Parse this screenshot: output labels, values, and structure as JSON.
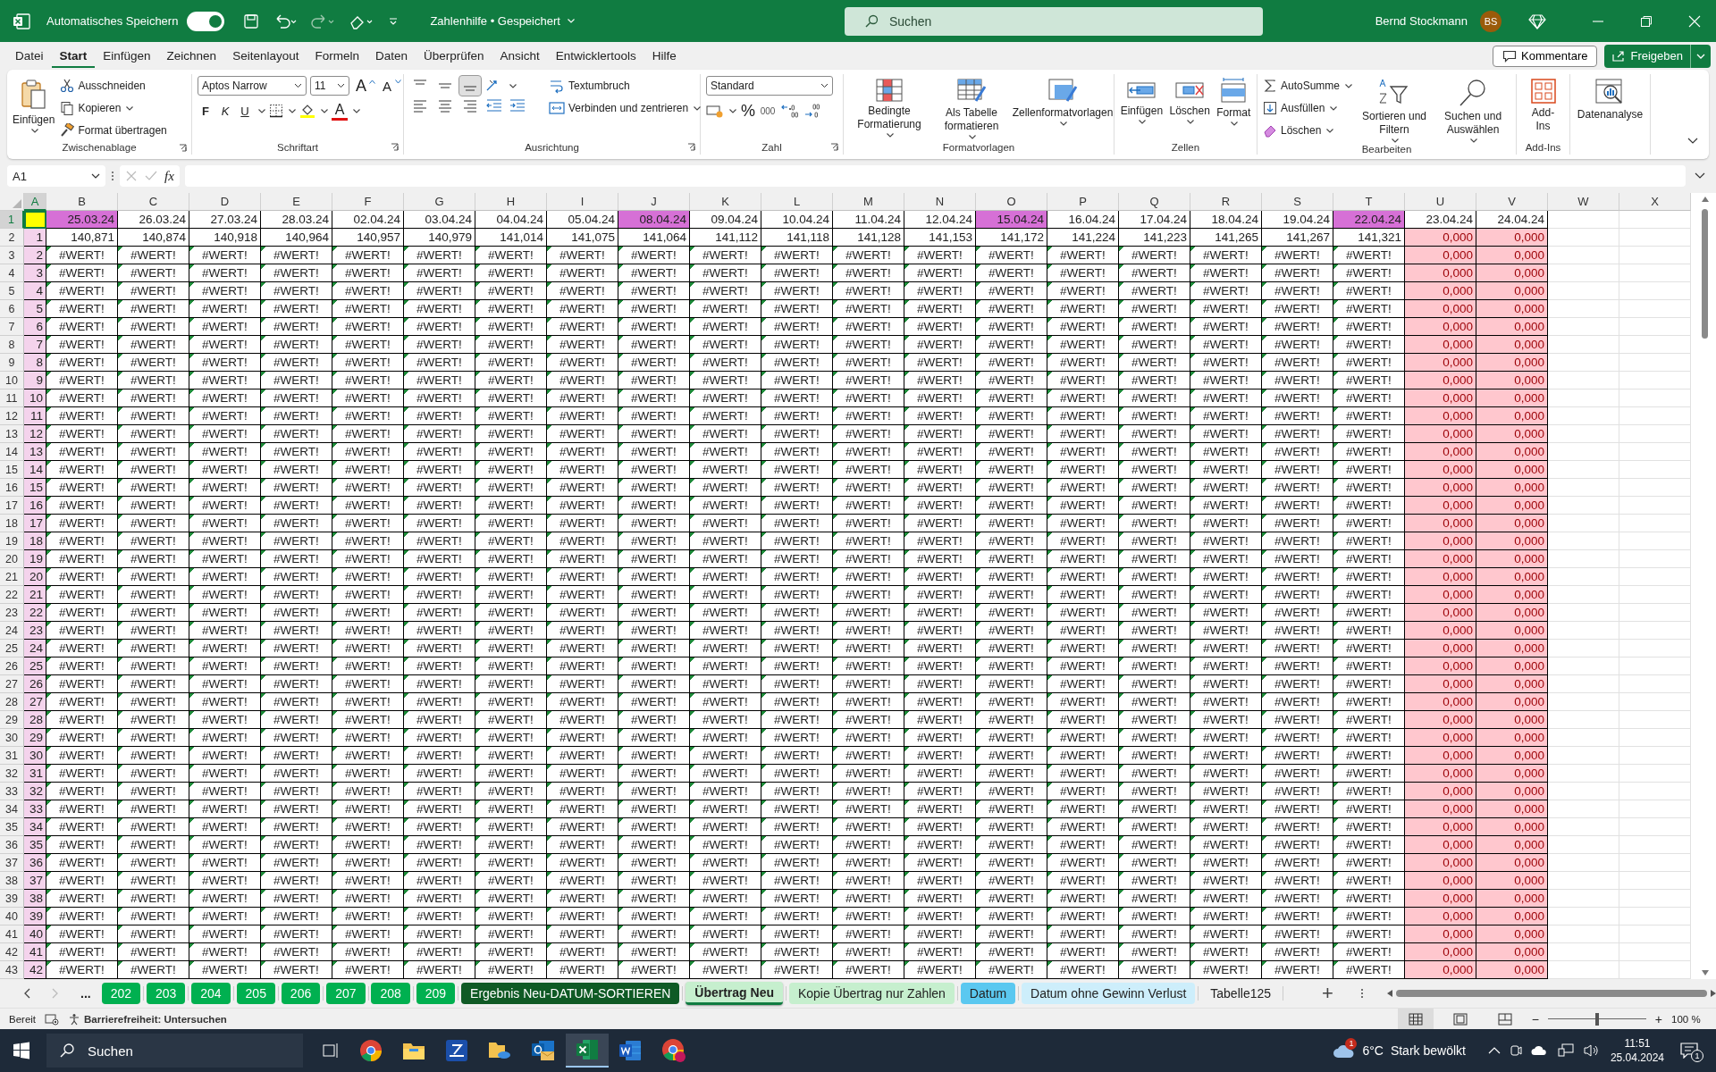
{
  "title_bar": {
    "autosave_label": "Automatisches Speichern",
    "autosave_on": true,
    "document_title": "Zahlenhilfe • Gespeichert",
    "search_placeholder": "Suchen",
    "user_name": "Bernd Stockmann",
    "user_initials": "BS"
  },
  "menu_tabs": [
    {
      "label": "Datei",
      "selected": false
    },
    {
      "label": "Start",
      "selected": true
    },
    {
      "label": "Einfügen",
      "selected": false
    },
    {
      "label": "Zeichnen",
      "selected": false
    },
    {
      "label": "Seitenlayout",
      "selected": false
    },
    {
      "label": "Formeln",
      "selected": false
    },
    {
      "label": "Daten",
      "selected": false
    },
    {
      "label": "Überprüfen",
      "selected": false
    },
    {
      "label": "Ansicht",
      "selected": false
    },
    {
      "label": "Entwicklertools",
      "selected": false
    },
    {
      "label": "Hilfe",
      "selected": false
    }
  ],
  "comments_button": "Kommentare",
  "share_button": "Freigeben",
  "ribbon": {
    "clipboard": {
      "title": "Zwischenablage",
      "paste": "Einfügen",
      "cut": "Ausschneiden",
      "copy": "Kopieren",
      "painter": "Format übertragen"
    },
    "font": {
      "title": "Schriftart",
      "family": "Aptos Narrow",
      "size": "11",
      "grow": "A",
      "shrink": "A",
      "bold": "F",
      "italic": "K",
      "underline": "U",
      "color_letter": "A"
    },
    "alignment": {
      "title": "Ausrichtung",
      "wrap": "Textumbruch",
      "merge": "Verbinden und zentrieren"
    },
    "number": {
      "title": "Zahl",
      "format": "Standard",
      "percent": "%",
      "thousands": "000"
    },
    "styles": {
      "title": "Formatvorlagen",
      "conditional": "Bedingte Formatierung",
      "as_table": "Als Tabelle formatieren",
      "cell_styles": "Zellenformatvorlagen"
    },
    "cells": {
      "title": "Zellen",
      "insert": "Einfügen",
      "delete": "Löschen",
      "format": "Format"
    },
    "editing": {
      "title": "Bearbeiten",
      "autosum": "AutoSumme",
      "fill": "Ausfüllen",
      "clear": "Löschen",
      "sort": "Sortieren und Filtern",
      "find": "Suchen und Auswählen"
    },
    "addins": {
      "title": "Add-Ins",
      "button": "Add-Ins"
    },
    "analysis": {
      "button": "Datenanalyse"
    }
  },
  "formula_bar": {
    "name_box": "A1",
    "fx": "fx"
  },
  "sheet": {
    "columns": [
      {
        "label": "A",
        "kind": "index",
        "selected": true
      },
      {
        "label": "B",
        "kind": "value",
        "selected": false
      },
      {
        "label": "C",
        "kind": "value",
        "selected": false
      },
      {
        "label": "D",
        "kind": "value",
        "selected": false
      },
      {
        "label": "E",
        "kind": "value",
        "selected": false
      },
      {
        "label": "F",
        "kind": "value",
        "selected": false
      },
      {
        "label": "G",
        "kind": "value",
        "selected": false
      },
      {
        "label": "H",
        "kind": "value",
        "selected": false
      },
      {
        "label": "I",
        "kind": "value",
        "selected": false
      },
      {
        "label": "J",
        "kind": "value",
        "selected": false
      },
      {
        "label": "K",
        "kind": "value",
        "selected": false
      },
      {
        "label": "L",
        "kind": "value",
        "selected": false
      },
      {
        "label": "M",
        "kind": "value",
        "selected": false
      },
      {
        "label": "N",
        "kind": "value",
        "selected": false
      },
      {
        "label": "O",
        "kind": "value",
        "selected": false
      },
      {
        "label": "P",
        "kind": "value",
        "selected": false
      },
      {
        "label": "Q",
        "kind": "value",
        "selected": false
      },
      {
        "label": "R",
        "kind": "value",
        "selected": false
      },
      {
        "label": "S",
        "kind": "value",
        "selected": false
      },
      {
        "label": "T",
        "kind": "value",
        "selected": false
      },
      {
        "label": "U",
        "kind": "alert",
        "selected": false
      },
      {
        "label": "V",
        "kind": "alert",
        "selected": false
      },
      {
        "label": "W",
        "kind": "blank",
        "selected": false
      },
      {
        "label": "X",
        "kind": "blank",
        "selected": false
      }
    ],
    "rows": [
      {
        "label": "1",
        "selected": true,
        "flagged": false,
        "cells": [
          {
            "color": "#ffff00"
          },
          {
            "text": "25.03.24",
            "color": "#d670d6"
          },
          {
            "text": "26.03.24"
          },
          {
            "text": "27.03.24"
          },
          {
            "text": "28.03.24"
          },
          {
            "text": "02.04.24"
          },
          {
            "text": "03.04.24"
          },
          {
            "text": "04.04.24"
          },
          {
            "text": "05.04.24"
          },
          {
            "text": "08.04.24",
            "color": "#d670d6"
          },
          {
            "text": "09.04.24"
          },
          {
            "text": "10.04.24"
          },
          {
            "text": "11.04.24"
          },
          {
            "text": "12.04.24"
          },
          {
            "text": "15.04.24",
            "color": "#d670d6"
          },
          {
            "text": "16.04.24"
          },
          {
            "text": "17.04.24"
          },
          {
            "text": "18.04.24"
          },
          {
            "text": "19.04.24"
          },
          {
            "text": "22.04.24",
            "color": "#d670d6"
          },
          {
            "text": "23.04.24"
          },
          {
            "text": "24.04.24"
          }
        ]
      },
      {
        "label": "2",
        "selected": false,
        "flagged": false,
        "cells": [
          "1",
          "140,871",
          "140,874",
          "140,918",
          "140,964",
          "140,957",
          "140,979",
          "141,014",
          "141,075",
          "141,064",
          "141,112",
          "141,118",
          "141,128",
          "141,153",
          "141,172",
          "141,224",
          "141,223",
          "141,265",
          "141,267",
          "141,321",
          "0,000",
          "0,000"
        ]
      },
      {
        "label": "3",
        "selected": false,
        "flagged": true,
        "cells": [
          "2",
          "#WERT!",
          "#WERT!",
          "#WERT!",
          "#WERT!",
          "#WERT!",
          "#WERT!",
          "#WERT!",
          "#WERT!",
          "#WERT!",
          "#WERT!",
          "#WERT!",
          "#WERT!",
          "#WERT!",
          "#WERT!",
          "#WERT!",
          "#WERT!",
          "#WERT!",
          "#WERT!",
          "#WERT!",
          "0,000",
          "0,000"
        ]
      },
      {
        "label": "4",
        "selected": false,
        "flagged": true,
        "cells": [
          "3",
          "#WERT!",
          "#WERT!",
          "#WERT!",
          "#WERT!",
          "#WERT!",
          "#WERT!",
          "#WERT!",
          "#WERT!",
          "#WERT!",
          "#WERT!",
          "#WERT!",
          "#WERT!",
          "#WERT!",
          "#WERT!",
          "#WERT!",
          "#WERT!",
          "#WERT!",
          "#WERT!",
          "#WERT!",
          "0,000",
          "0,000"
        ]
      },
      {
        "label": "5",
        "selected": false,
        "flagged": true,
        "cells": [
          "4",
          "#WERT!",
          "#WERT!",
          "#WERT!",
          "#WERT!",
          "#WERT!",
          "#WERT!",
          "#WERT!",
          "#WERT!",
          "#WERT!",
          "#WERT!",
          "#WERT!",
          "#WERT!",
          "#WERT!",
          "#WERT!",
          "#WERT!",
          "#WERT!",
          "#WERT!",
          "#WERT!",
          "#WERT!",
          "0,000",
          "0,000"
        ]
      },
      {
        "label": "6",
        "selected": false,
        "flagged": true,
        "cells": [
          "5",
          "#WERT!",
          "#WERT!",
          "#WERT!",
          "#WERT!",
          "#WERT!",
          "#WERT!",
          "#WERT!",
          "#WERT!",
          "#WERT!",
          "#WERT!",
          "#WERT!",
          "#WERT!",
          "#WERT!",
          "#WERT!",
          "#WERT!",
          "#WERT!",
          "#WERT!",
          "#WERT!",
          "#WERT!",
          "0,000",
          "0,000"
        ]
      },
      {
        "label": "7",
        "selected": false,
        "flagged": true,
        "cells": [
          "6",
          "#WERT!",
          "#WERT!",
          "#WERT!",
          "#WERT!",
          "#WERT!",
          "#WERT!",
          "#WERT!",
          "#WERT!",
          "#WERT!",
          "#WERT!",
          "#WERT!",
          "#WERT!",
          "#WERT!",
          "#WERT!",
          "#WERT!",
          "#WERT!",
          "#WERT!",
          "#WERT!",
          "#WERT!",
          "0,000",
          "0,000"
        ]
      },
      {
        "label": "8",
        "selected": false,
        "flagged": true,
        "cells": [
          "7",
          "#WERT!",
          "#WERT!",
          "#WERT!",
          "#WERT!",
          "#WERT!",
          "#WERT!",
          "#WERT!",
          "#WERT!",
          "#WERT!",
          "#WERT!",
          "#WERT!",
          "#WERT!",
          "#WERT!",
          "#WERT!",
          "#WERT!",
          "#WERT!",
          "#WERT!",
          "#WERT!",
          "#WERT!",
          "0,000",
          "0,000"
        ]
      },
      {
        "label": "9",
        "selected": false,
        "flagged": true,
        "cells": [
          "8",
          "#WERT!",
          "#WERT!",
          "#WERT!",
          "#WERT!",
          "#WERT!",
          "#WERT!",
          "#WERT!",
          "#WERT!",
          "#WERT!",
          "#WERT!",
          "#WERT!",
          "#WERT!",
          "#WERT!",
          "#WERT!",
          "#WERT!",
          "#WERT!",
          "#WERT!",
          "#WERT!",
          "#WERT!",
          "0,000",
          "0,000"
        ]
      },
      {
        "label": "10",
        "selected": false,
        "flagged": true,
        "cells": [
          "9",
          "#WERT!",
          "#WERT!",
          "#WERT!",
          "#WERT!",
          "#WERT!",
          "#WERT!",
          "#WERT!",
          "#WERT!",
          "#WERT!",
          "#WERT!",
          "#WERT!",
          "#WERT!",
          "#WERT!",
          "#WERT!",
          "#WERT!",
          "#WERT!",
          "#WERT!",
          "#WERT!",
          "#WERT!",
          "0,000",
          "0,000"
        ]
      },
      {
        "label": "11",
        "selected": false,
        "flagged": true,
        "cells": [
          "10",
          "#WERT!",
          "#WERT!",
          "#WERT!",
          "#WERT!",
          "#WERT!",
          "#WERT!",
          "#WERT!",
          "#WERT!",
          "#WERT!",
          "#WERT!",
          "#WERT!",
          "#WERT!",
          "#WERT!",
          "#WERT!",
          "#WERT!",
          "#WERT!",
          "#WERT!",
          "#WERT!",
          "#WERT!",
          "0,000",
          "0,000"
        ]
      },
      {
        "label": "12",
        "selected": false,
        "flagged": true,
        "cells": [
          "11",
          "#WERT!",
          "#WERT!",
          "#WERT!",
          "#WERT!",
          "#WERT!",
          "#WERT!",
          "#WERT!",
          "#WERT!",
          "#WERT!",
          "#WERT!",
          "#WERT!",
          "#WERT!",
          "#WERT!",
          "#WERT!",
          "#WERT!",
          "#WERT!",
          "#WERT!",
          "#WERT!",
          "#WERT!",
          "0,000",
          "0,000"
        ]
      },
      {
        "label": "13",
        "selected": false,
        "flagged": true,
        "cells": [
          "12",
          "#WERT!",
          "#WERT!",
          "#WERT!",
          "#WERT!",
          "#WERT!",
          "#WERT!",
          "#WERT!",
          "#WERT!",
          "#WERT!",
          "#WERT!",
          "#WERT!",
          "#WERT!",
          "#WERT!",
          "#WERT!",
          "#WERT!",
          "#WERT!",
          "#WERT!",
          "#WERT!",
          "#WERT!",
          "0,000",
          "0,000"
        ]
      },
      {
        "label": "14",
        "selected": false,
        "flagged": true,
        "cells": [
          "13",
          "#WERT!",
          "#WERT!",
          "#WERT!",
          "#WERT!",
          "#WERT!",
          "#WERT!",
          "#WERT!",
          "#WERT!",
          "#WERT!",
          "#WERT!",
          "#WERT!",
          "#WERT!",
          "#WERT!",
          "#WERT!",
          "#WERT!",
          "#WERT!",
          "#WERT!",
          "#WERT!",
          "#WERT!",
          "0,000",
          "0,000"
        ]
      },
      {
        "label": "15",
        "selected": false,
        "flagged": true,
        "cells": [
          "14",
          "#WERT!",
          "#WERT!",
          "#WERT!",
          "#WERT!",
          "#WERT!",
          "#WERT!",
          "#WERT!",
          "#WERT!",
          "#WERT!",
          "#WERT!",
          "#WERT!",
          "#WERT!",
          "#WERT!",
          "#WERT!",
          "#WERT!",
          "#WERT!",
          "#WERT!",
          "#WERT!",
          "#WERT!",
          "0,000",
          "0,000"
        ]
      },
      {
        "label": "16",
        "selected": false,
        "flagged": true,
        "cells": [
          "15",
          "#WERT!",
          "#WERT!",
          "#WERT!",
          "#WERT!",
          "#WERT!",
          "#WERT!",
          "#WERT!",
          "#WERT!",
          "#WERT!",
          "#WERT!",
          "#WERT!",
          "#WERT!",
          "#WERT!",
          "#WERT!",
          "#WERT!",
          "#WERT!",
          "#WERT!",
          "#WERT!",
          "#WERT!",
          "0,000",
          "0,000"
        ]
      },
      {
        "label": "17",
        "selected": false,
        "flagged": true,
        "cells": [
          "16",
          "#WERT!",
          "#WERT!",
          "#WERT!",
          "#WERT!",
          "#WERT!",
          "#WERT!",
          "#WERT!",
          "#WERT!",
          "#WERT!",
          "#WERT!",
          "#WERT!",
          "#WERT!",
          "#WERT!",
          "#WERT!",
          "#WERT!",
          "#WERT!",
          "#WERT!",
          "#WERT!",
          "#WERT!",
          "0,000",
          "0,000"
        ]
      },
      {
        "label": "18",
        "selected": false,
        "flagged": true,
        "cells": [
          "17",
          "#WERT!",
          "#WERT!",
          "#WERT!",
          "#WERT!",
          "#WERT!",
          "#WERT!",
          "#WERT!",
          "#WERT!",
          "#WERT!",
          "#WERT!",
          "#WERT!",
          "#WERT!",
          "#WERT!",
          "#WERT!",
          "#WERT!",
          "#WERT!",
          "#WERT!",
          "#WERT!",
          "#WERT!",
          "0,000",
          "0,000"
        ]
      },
      {
        "label": "19",
        "selected": false,
        "flagged": true,
        "cells": [
          "18",
          "#WERT!",
          "#WERT!",
          "#WERT!",
          "#WERT!",
          "#WERT!",
          "#WERT!",
          "#WERT!",
          "#WERT!",
          "#WERT!",
          "#WERT!",
          "#WERT!",
          "#WERT!",
          "#WERT!",
          "#WERT!",
          "#WERT!",
          "#WERT!",
          "#WERT!",
          "#WERT!",
          "#WERT!",
          "0,000",
          "0,000"
        ]
      },
      {
        "label": "20",
        "selected": false,
        "flagged": true,
        "cells": [
          "19",
          "#WERT!",
          "#WERT!",
          "#WERT!",
          "#WERT!",
          "#WERT!",
          "#WERT!",
          "#WERT!",
          "#WERT!",
          "#WERT!",
          "#WERT!",
          "#WERT!",
          "#WERT!",
          "#WERT!",
          "#WERT!",
          "#WERT!",
          "#WERT!",
          "#WERT!",
          "#WERT!",
          "#WERT!",
          "0,000",
          "0,000"
        ]
      },
      {
        "label": "21",
        "selected": false,
        "flagged": true,
        "cells": [
          "20",
          "#WERT!",
          "#WERT!",
          "#WERT!",
          "#WERT!",
          "#WERT!",
          "#WERT!",
          "#WERT!",
          "#WERT!",
          "#WERT!",
          "#WERT!",
          "#WERT!",
          "#WERT!",
          "#WERT!",
          "#WERT!",
          "#WERT!",
          "#WERT!",
          "#WERT!",
          "#WERT!",
          "#WERT!",
          "0,000",
          "0,000"
        ]
      },
      {
        "label": "22",
        "selected": false,
        "flagged": true,
        "cells": [
          "21",
          "#WERT!",
          "#WERT!",
          "#WERT!",
          "#WERT!",
          "#WERT!",
          "#WERT!",
          "#WERT!",
          "#WERT!",
          "#WERT!",
          "#WERT!",
          "#WERT!",
          "#WERT!",
          "#WERT!",
          "#WERT!",
          "#WERT!",
          "#WERT!",
          "#WERT!",
          "#WERT!",
          "#WERT!",
          "0,000",
          "0,000"
        ]
      },
      {
        "label": "23",
        "selected": false,
        "flagged": true,
        "cells": [
          "22",
          "#WERT!",
          "#WERT!",
          "#WERT!",
          "#WERT!",
          "#WERT!",
          "#WERT!",
          "#WERT!",
          "#WERT!",
          "#WERT!",
          "#WERT!",
          "#WERT!",
          "#WERT!",
          "#WERT!",
          "#WERT!",
          "#WERT!",
          "#WERT!",
          "#WERT!",
          "#WERT!",
          "#WERT!",
          "0,000",
          "0,000"
        ]
      },
      {
        "label": "24",
        "selected": false,
        "flagged": true,
        "cells": [
          "23",
          "#WERT!",
          "#WERT!",
          "#WERT!",
          "#WERT!",
          "#WERT!",
          "#WERT!",
          "#WERT!",
          "#WERT!",
          "#WERT!",
          "#WERT!",
          "#WERT!",
          "#WERT!",
          "#WERT!",
          "#WERT!",
          "#WERT!",
          "#WERT!",
          "#WERT!",
          "#WERT!",
          "#WERT!",
          "0,000",
          "0,000"
        ]
      },
      {
        "label": "25",
        "selected": false,
        "flagged": true,
        "cells": [
          "24",
          "#WERT!",
          "#WERT!",
          "#WERT!",
          "#WERT!",
          "#WERT!",
          "#WERT!",
          "#WERT!",
          "#WERT!",
          "#WERT!",
          "#WERT!",
          "#WERT!",
          "#WERT!",
          "#WERT!",
          "#WERT!",
          "#WERT!",
          "#WERT!",
          "#WERT!",
          "#WERT!",
          "#WERT!",
          "0,000",
          "0,000"
        ]
      },
      {
        "label": "26",
        "selected": false,
        "flagged": true,
        "cells": [
          "25",
          "#WERT!",
          "#WERT!",
          "#WERT!",
          "#WERT!",
          "#WERT!",
          "#WERT!",
          "#WERT!",
          "#WERT!",
          "#WERT!",
          "#WERT!",
          "#WERT!",
          "#WERT!",
          "#WERT!",
          "#WERT!",
          "#WERT!",
          "#WERT!",
          "#WERT!",
          "#WERT!",
          "#WERT!",
          "0,000",
          "0,000"
        ]
      },
      {
        "label": "27",
        "selected": false,
        "flagged": true,
        "cells": [
          "26",
          "#WERT!",
          "#WERT!",
          "#WERT!",
          "#WERT!",
          "#WERT!",
          "#WERT!",
          "#WERT!",
          "#WERT!",
          "#WERT!",
          "#WERT!",
          "#WERT!",
          "#WERT!",
          "#WERT!",
          "#WERT!",
          "#WERT!",
          "#WERT!",
          "#WERT!",
          "#WERT!",
          "#WERT!",
          "0,000",
          "0,000"
        ]
      },
      {
        "label": "28",
        "selected": false,
        "flagged": true,
        "cells": [
          "27",
          "#WERT!",
          "#WERT!",
          "#WERT!",
          "#WERT!",
          "#WERT!",
          "#WERT!",
          "#WERT!",
          "#WERT!",
          "#WERT!",
          "#WERT!",
          "#WERT!",
          "#WERT!",
          "#WERT!",
          "#WERT!",
          "#WERT!",
          "#WERT!",
          "#WERT!",
          "#WERT!",
          "#WERT!",
          "0,000",
          "0,000"
        ]
      },
      {
        "label": "29",
        "selected": false,
        "flagged": true,
        "cells": [
          "28",
          "#WERT!",
          "#WERT!",
          "#WERT!",
          "#WERT!",
          "#WERT!",
          "#WERT!",
          "#WERT!",
          "#WERT!",
          "#WERT!",
          "#WERT!",
          "#WERT!",
          "#WERT!",
          "#WERT!",
          "#WERT!",
          "#WERT!",
          "#WERT!",
          "#WERT!",
          "#WERT!",
          "#WERT!",
          "0,000",
          "0,000"
        ]
      },
      {
        "label": "30",
        "selected": false,
        "flagged": true,
        "cells": [
          "29",
          "#WERT!",
          "#WERT!",
          "#WERT!",
          "#WERT!",
          "#WERT!",
          "#WERT!",
          "#WERT!",
          "#WERT!",
          "#WERT!",
          "#WERT!",
          "#WERT!",
          "#WERT!",
          "#WERT!",
          "#WERT!",
          "#WERT!",
          "#WERT!",
          "#WERT!",
          "#WERT!",
          "#WERT!",
          "0,000",
          "0,000"
        ]
      },
      {
        "label": "31",
        "selected": false,
        "flagged": true,
        "cells": [
          "30",
          "#WERT!",
          "#WERT!",
          "#WERT!",
          "#WERT!",
          "#WERT!",
          "#WERT!",
          "#WERT!",
          "#WERT!",
          "#WERT!",
          "#WERT!",
          "#WERT!",
          "#WERT!",
          "#WERT!",
          "#WERT!",
          "#WERT!",
          "#WERT!",
          "#WERT!",
          "#WERT!",
          "#WERT!",
          "0,000",
          "0,000"
        ]
      },
      {
        "label": "32",
        "selected": false,
        "flagged": true,
        "cells": [
          "31",
          "#WERT!",
          "#WERT!",
          "#WERT!",
          "#WERT!",
          "#WERT!",
          "#WERT!",
          "#WERT!",
          "#WERT!",
          "#WERT!",
          "#WERT!",
          "#WERT!",
          "#WERT!",
          "#WERT!",
          "#WERT!",
          "#WERT!",
          "#WERT!",
          "#WERT!",
          "#WERT!",
          "#WERT!",
          "0,000",
          "0,000"
        ]
      },
      {
        "label": "33",
        "selected": false,
        "flagged": true,
        "cells": [
          "32",
          "#WERT!",
          "#WERT!",
          "#WERT!",
          "#WERT!",
          "#WERT!",
          "#WERT!",
          "#WERT!",
          "#WERT!",
          "#WERT!",
          "#WERT!",
          "#WERT!",
          "#WERT!",
          "#WERT!",
          "#WERT!",
          "#WERT!",
          "#WERT!",
          "#WERT!",
          "#WERT!",
          "#WERT!",
          "0,000",
          "0,000"
        ]
      },
      {
        "label": "34",
        "selected": false,
        "flagged": true,
        "cells": [
          "33",
          "#WERT!",
          "#WERT!",
          "#WERT!",
          "#WERT!",
          "#WERT!",
          "#WERT!",
          "#WERT!",
          "#WERT!",
          "#WERT!",
          "#WERT!",
          "#WERT!",
          "#WERT!",
          "#WERT!",
          "#WERT!",
          "#WERT!",
          "#WERT!",
          "#WERT!",
          "#WERT!",
          "#WERT!",
          "0,000",
          "0,000"
        ]
      },
      {
        "label": "35",
        "selected": false,
        "flagged": true,
        "cells": [
          "34",
          "#WERT!",
          "#WERT!",
          "#WERT!",
          "#WERT!",
          "#WERT!",
          "#WERT!",
          "#WERT!",
          "#WERT!",
          "#WERT!",
          "#WERT!",
          "#WERT!",
          "#WERT!",
          "#WERT!",
          "#WERT!",
          "#WERT!",
          "#WERT!",
          "#WERT!",
          "#WERT!",
          "#WERT!",
          "0,000",
          "0,000"
        ]
      },
      {
        "label": "36",
        "selected": false,
        "flagged": true,
        "cells": [
          "35",
          "#WERT!",
          "#WERT!",
          "#WERT!",
          "#WERT!",
          "#WERT!",
          "#WERT!",
          "#WERT!",
          "#WERT!",
          "#WERT!",
          "#WERT!",
          "#WERT!",
          "#WERT!",
          "#WERT!",
          "#WERT!",
          "#WERT!",
          "#WERT!",
          "#WERT!",
          "#WERT!",
          "#WERT!",
          "0,000",
          "0,000"
        ]
      },
      {
        "label": "37",
        "selected": false,
        "flagged": true,
        "cells": [
          "36",
          "#WERT!",
          "#WERT!",
          "#WERT!",
          "#WERT!",
          "#WERT!",
          "#WERT!",
          "#WERT!",
          "#WERT!",
          "#WERT!",
          "#WERT!",
          "#WERT!",
          "#WERT!",
          "#WERT!",
          "#WERT!",
          "#WERT!",
          "#WERT!",
          "#WERT!",
          "#WERT!",
          "#WERT!",
          "0,000",
          "0,000"
        ]
      },
      {
        "label": "38",
        "selected": false,
        "flagged": true,
        "cells": [
          "37",
          "#WERT!",
          "#WERT!",
          "#WERT!",
          "#WERT!",
          "#WERT!",
          "#WERT!",
          "#WERT!",
          "#WERT!",
          "#WERT!",
          "#WERT!",
          "#WERT!",
          "#WERT!",
          "#WERT!",
          "#WERT!",
          "#WERT!",
          "#WERT!",
          "#WERT!",
          "#WERT!",
          "#WERT!",
          "0,000",
          "0,000"
        ]
      },
      {
        "label": "39",
        "selected": false,
        "flagged": true,
        "cells": [
          "38",
          "#WERT!",
          "#WERT!",
          "#WERT!",
          "#WERT!",
          "#WERT!",
          "#WERT!",
          "#WERT!",
          "#WERT!",
          "#WERT!",
          "#WERT!",
          "#WERT!",
          "#WERT!",
          "#WERT!",
          "#WERT!",
          "#WERT!",
          "#WERT!",
          "#WERT!",
          "#WERT!",
          "#WERT!",
          "0,000",
          "0,000"
        ]
      },
      {
        "label": "40",
        "selected": false,
        "flagged": true,
        "cells": [
          "39",
          "#WERT!",
          "#WERT!",
          "#WERT!",
          "#WERT!",
          "#WERT!",
          "#WERT!",
          "#WERT!",
          "#WERT!",
          "#WERT!",
          "#WERT!",
          "#WERT!",
          "#WERT!",
          "#WERT!",
          "#WERT!",
          "#WERT!",
          "#WERT!",
          "#WERT!",
          "#WERT!",
          "#WERT!",
          "0,000",
          "0,000"
        ]
      },
      {
        "label": "41",
        "selected": false,
        "flagged": true,
        "cells": [
          "40",
          "#WERT!",
          "#WERT!",
          "#WERT!",
          "#WERT!",
          "#WERT!",
          "#WERT!",
          "#WERT!",
          "#WERT!",
          "#WERT!",
          "#WERT!",
          "#WERT!",
          "#WERT!",
          "#WERT!",
          "#WERT!",
          "#WERT!",
          "#WERT!",
          "#WERT!",
          "#WERT!",
          "#WERT!",
          "0,000",
          "0,000"
        ]
      },
      {
        "label": "42",
        "selected": false,
        "flagged": true,
        "cells": [
          "41",
          "#WERT!",
          "#WERT!",
          "#WERT!",
          "#WERT!",
          "#WERT!",
          "#WERT!",
          "#WERT!",
          "#WERT!",
          "#WERT!",
          "#WERT!",
          "#WERT!",
          "#WERT!",
          "#WERT!",
          "#WERT!",
          "#WERT!",
          "#WERT!",
          "#WERT!",
          "#WERT!",
          "#WERT!",
          "0,000",
          "0,000"
        ]
      },
      {
        "label": "43",
        "selected": false,
        "flagged": true,
        "cells": [
          "42",
          "#WERT!",
          "#WERT!",
          "#WERT!",
          "#WERT!",
          "#WERT!",
          "#WERT!",
          "#WERT!",
          "#WERT!",
          "#WERT!",
          "#WERT!",
          "#WERT!",
          "#WERT!",
          "#WERT!",
          "#WERT!",
          "#WERT!",
          "#WERT!",
          "#WERT!",
          "#WERT!",
          "#WERT!",
          "0,000",
          "0,000"
        ]
      }
    ]
  },
  "sheet_tabs": {
    "more": "...",
    "add": "+",
    "tabs": [
      {
        "label": "202",
        "color": "#00b050",
        "selected": false
      },
      {
        "label": "203",
        "color": "#00b050",
        "selected": false
      },
      {
        "label": "204",
        "color": "#00b050",
        "selected": false
      },
      {
        "label": "205",
        "color": "#00b050",
        "selected": false
      },
      {
        "label": "206",
        "color": "#00b050",
        "selected": false
      },
      {
        "label": "207",
        "color": "#00b050",
        "selected": false
      },
      {
        "label": "208",
        "color": "#00b050",
        "selected": false
      },
      {
        "label": "209",
        "color": "#00b050",
        "selected": false
      },
      {
        "label": "Ergebnis Neu-DATUM-SORTIEREN",
        "color": "#0f5a25",
        "selected": false
      },
      {
        "label": "Übertrag Neu",
        "color": "#c6efce",
        "selected": true
      },
      {
        "label": "Kopie Übertrag nur Zahlen",
        "color": "#c6efce",
        "selected": false
      },
      {
        "label": "Datum",
        "color": "#5bc8f0",
        "selected": false
      },
      {
        "label": "Datum ohne Gewinn Verlust",
        "color": "#cdeefb",
        "selected": false
      },
      {
        "label": "Tabelle125",
        "selected": false
      }
    ]
  },
  "status_bar": {
    "status": "Bereit",
    "accessibility": "Barrierefreiheit: Untersuchen",
    "zoom_out": "−",
    "zoom_slider": {
      "level": 0.5
    },
    "zoom_in": "+",
    "zoom": "100 %"
  },
  "taskbar": {
    "search": "Suchen",
    "weather_badge": "1",
    "temperature": "6°C",
    "weather": "Stark bewölkt",
    "time": "11:51",
    "date": "25.04.2024",
    "notifications": "1"
  }
}
